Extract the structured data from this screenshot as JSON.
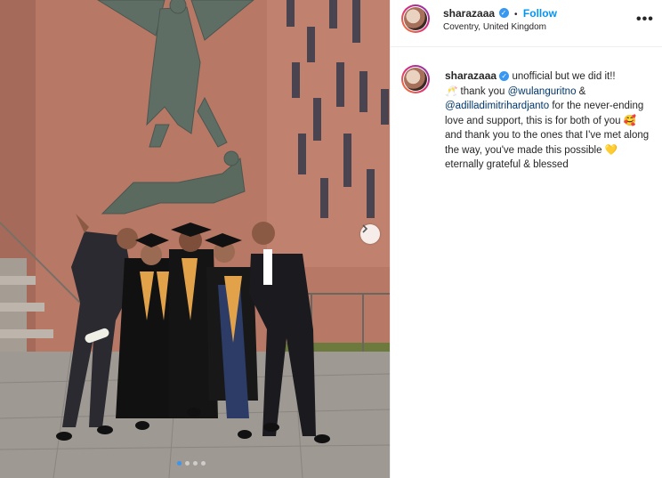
{
  "post": {
    "username": "sharazaaa",
    "follow_label": "Follow",
    "separator": "•",
    "location": "Coventry, United Kingdom",
    "more_label": "•••"
  },
  "caption": {
    "username": "sharazaaa",
    "part1": "unofficial but we did it!!",
    "emoji1": "🥂",
    "part2": " thank you ",
    "mention1": "@wulanguritno",
    "part3": " & ",
    "mention2": "@adilladimitrihardjanto",
    "part4": " for the never-ending love and support, this is for both of you ",
    "emoji2": "🥰",
    "part5": " and thank you to the ones that I've met along the way, you've made this possible ",
    "emoji3": "💛",
    "part6": " eternally grateful & blessed"
  },
  "carousel": {
    "total_slides": 4,
    "active_slide": 1,
    "next_icon": "chevron-right-icon"
  },
  "colors": {
    "accent": "#0095f6",
    "verified": "#3897f0",
    "mention": "#00376b"
  }
}
